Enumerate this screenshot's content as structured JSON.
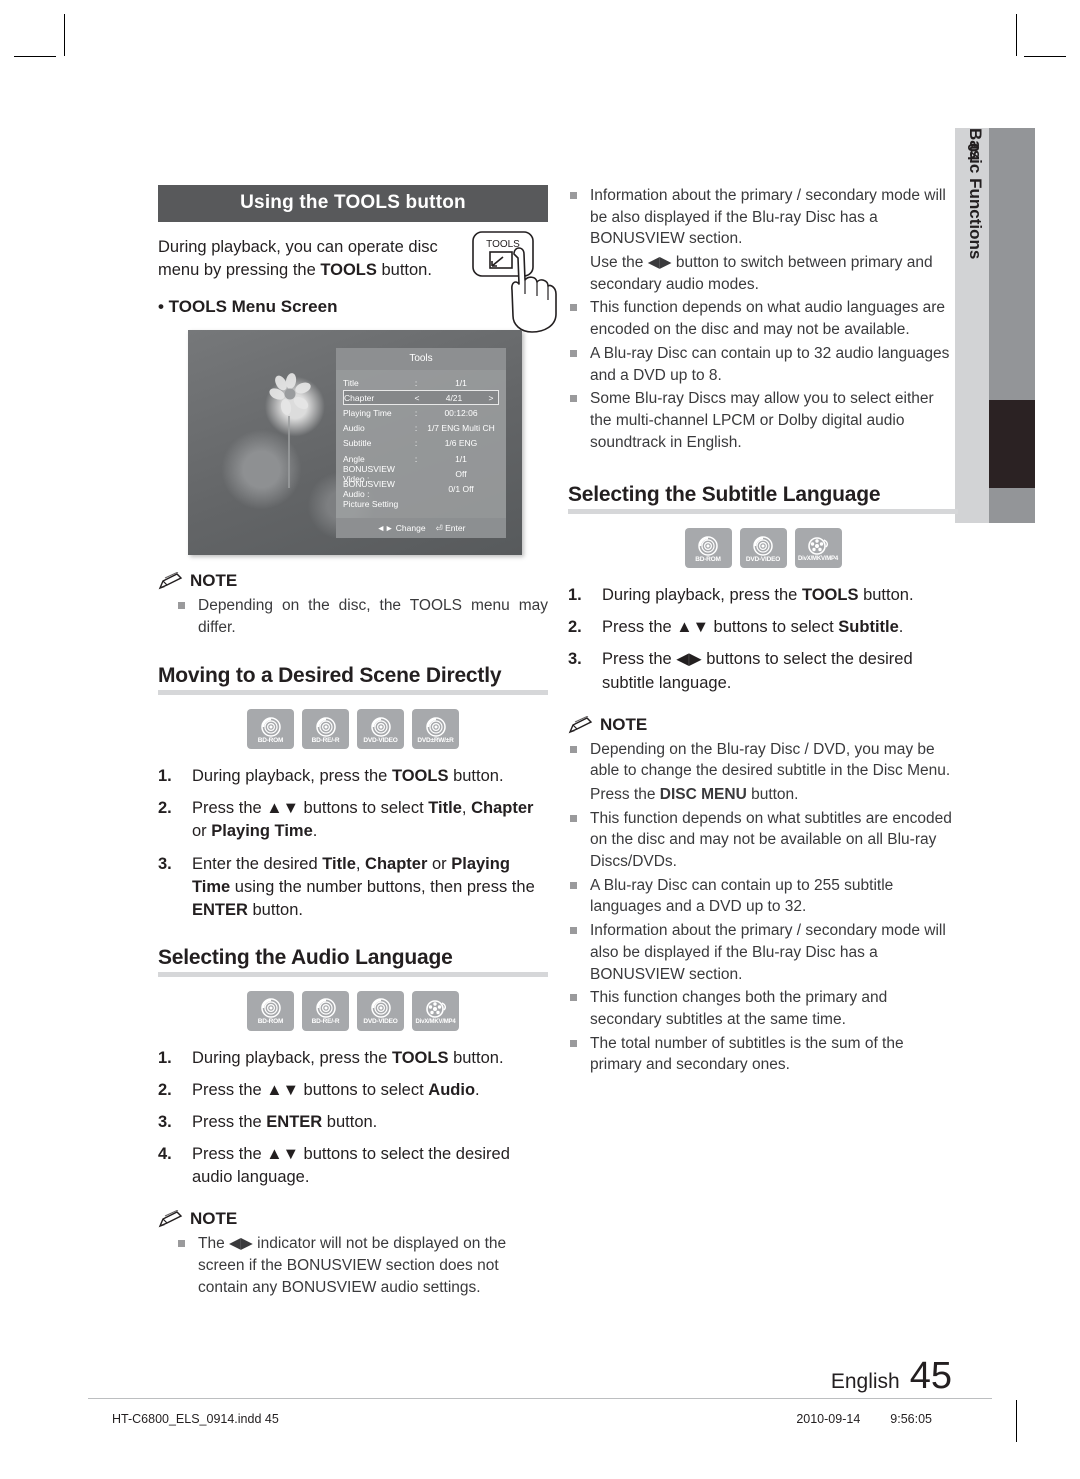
{
  "sidetab": {
    "number": "04",
    "label": "Basic Functions"
  },
  "left_column": {
    "bar_heading": "Using the TOOLS button",
    "intro_1": "During playback, you can operate disc",
    "intro_2_pre": "menu by pressing the ",
    "intro_2_bold": "TOOLS",
    "intro_2_post": " button.",
    "bullet_label": "• TOOLS Menu Screen",
    "remote_button_label": "TOOLS",
    "osd": {
      "title": "Tools",
      "rows": [
        {
          "key": "Title",
          "sep": ":",
          "value": "1/1",
          "selected": false
        },
        {
          "key": "Chapter",
          "sep": "<",
          "value": "4/21",
          "right": ">",
          "selected": true
        },
        {
          "key": "Playing Time",
          "sep": ":",
          "value": "00:12:06",
          "selected": false
        },
        {
          "key": "Audio",
          "sep": ":",
          "value": "1/7 ENG Multi CH",
          "selected": false
        },
        {
          "key": "Subtitle",
          "sep": ":",
          "value": "1/6 ENG",
          "selected": false
        },
        {
          "key": "Angle",
          "sep": ":",
          "value": "1/1",
          "selected": false
        },
        {
          "key": "BONUSVIEW Video :",
          "sep": "",
          "value": "Off",
          "selected": false
        },
        {
          "key": "BONUSVIEW Audio :",
          "sep": "",
          "value": "0/1 Off",
          "selected": false
        },
        {
          "key": "Picture Setting",
          "sep": "",
          "value": "",
          "selected": false
        }
      ],
      "footer_change": "Change",
      "footer_enter": "Enter"
    },
    "note1": {
      "heading": "NOTE",
      "items": [
        "Depending on the disc, the TOOLS menu may differ."
      ]
    },
    "heading_scene": "Moving to a Desired Scene Directly",
    "discs_scene": [
      {
        "name": "BD-ROM",
        "glyph": "disc"
      },
      {
        "name": "BD-RE/-R",
        "glyph": "disc"
      },
      {
        "name": "DVD-VIDEO",
        "glyph": "disc"
      },
      {
        "name": "DVD±RW/±R",
        "glyph": "disc"
      }
    ],
    "steps_scene": [
      {
        "n": "1.",
        "html": "During playback, press the <b>TOOLS</b> button."
      },
      {
        "n": "2.",
        "html": "Press the ▲▼ buttons to select <b>Title</b>, <b>Chapter</b> or <b>Playing Time</b>."
      },
      {
        "n": "3.",
        "html": "Enter the desired <b>Title</b>, <b>Chapter</b> or <b>Playing Time</b> using the number buttons, then press the <b>ENTER</b> button."
      }
    ],
    "heading_audio": "Selecting the Audio Language",
    "discs_audio": [
      {
        "name": "BD-ROM",
        "glyph": "disc"
      },
      {
        "name": "BD-RE/-R",
        "glyph": "disc"
      },
      {
        "name": "DVD-VIDEO",
        "glyph": "disc"
      },
      {
        "name": "DivX/MKV/MP4",
        "glyph": "film"
      }
    ],
    "steps_audio": [
      {
        "n": "1.",
        "html": "During playback, press the <b>TOOLS</b> button."
      },
      {
        "n": "2.",
        "html": "Press the ▲▼ buttons to select <b>Audio</b>."
      },
      {
        "n": "3.",
        "html": "Press the <b>ENTER</b> button."
      },
      {
        "n": "4.",
        "html": "Press the ▲▼ buttons to select the desired audio language."
      }
    ],
    "note2": {
      "heading": "NOTE",
      "items": [
        "The ◀▶ indicator will not be displayed on the screen if the BONUSVIEW section does not contain any BONUSVIEW audio settings."
      ]
    }
  },
  "right_column": {
    "note_top_items": [
      "Information about the primary / secondary mode will be also displayed if the Blu-ray Disc has a BONUSVIEW section.",
      "Use the ◀▶ button to switch between primary and secondary audio modes.",
      "This function depends on what audio languages are encoded on the disc and may not be available.",
      "A Blu-ray Disc can contain up to 32 audio languages and a DVD up to 8.",
      "Some Blu-ray Discs may allow you to select either the multi-channel LPCM or Dolby digital audio soundtrack in English."
    ],
    "heading_subtitle": "Selecting the Subtitle Language",
    "discs_subtitle": [
      {
        "name": "BD-ROM",
        "glyph": "disc"
      },
      {
        "name": "DVD-VIDEO",
        "glyph": "disc"
      },
      {
        "name": "DivX/MKV/MP4",
        "glyph": "film"
      }
    ],
    "steps_subtitle": [
      {
        "n": "1.",
        "html": "During playback, press the <b>TOOLS</b> button."
      },
      {
        "n": "2.",
        "html": "Press the ▲▼ buttons to select <b>Subtitle</b>."
      },
      {
        "n": "3.",
        "html": "Press the ◀▶ buttons to select the desired subtitle language."
      }
    ],
    "note_subtitle": {
      "heading": "NOTE",
      "items": [
        "Depending on the Blu-ray Disc / DVD, you may be able to change the desired subtitle in the Disc Menu.",
        "Press the <b>DISC MENU</b> button.",
        "This function depends on what subtitles are encoded on the disc and may not be available on all Blu-ray Discs/DVDs.",
        "A Blu-ray Disc can contain up to 255 subtitle languages and a DVD up to 32.",
        "Information about the primary / secondary mode will also be displayed if the Blu-ray Disc has a BONUSVIEW section.",
        "This function changes both the primary and secondary subtitles at the same time.",
        "The total number of subtitles is the sum of the primary and secondary ones."
      ]
    }
  },
  "footer": {
    "language": "English",
    "page_number": "45",
    "file_name": "HT-C6800_ELS_0914.indd   45",
    "date": "2010-09-14",
    "time": "9:56:05"
  }
}
